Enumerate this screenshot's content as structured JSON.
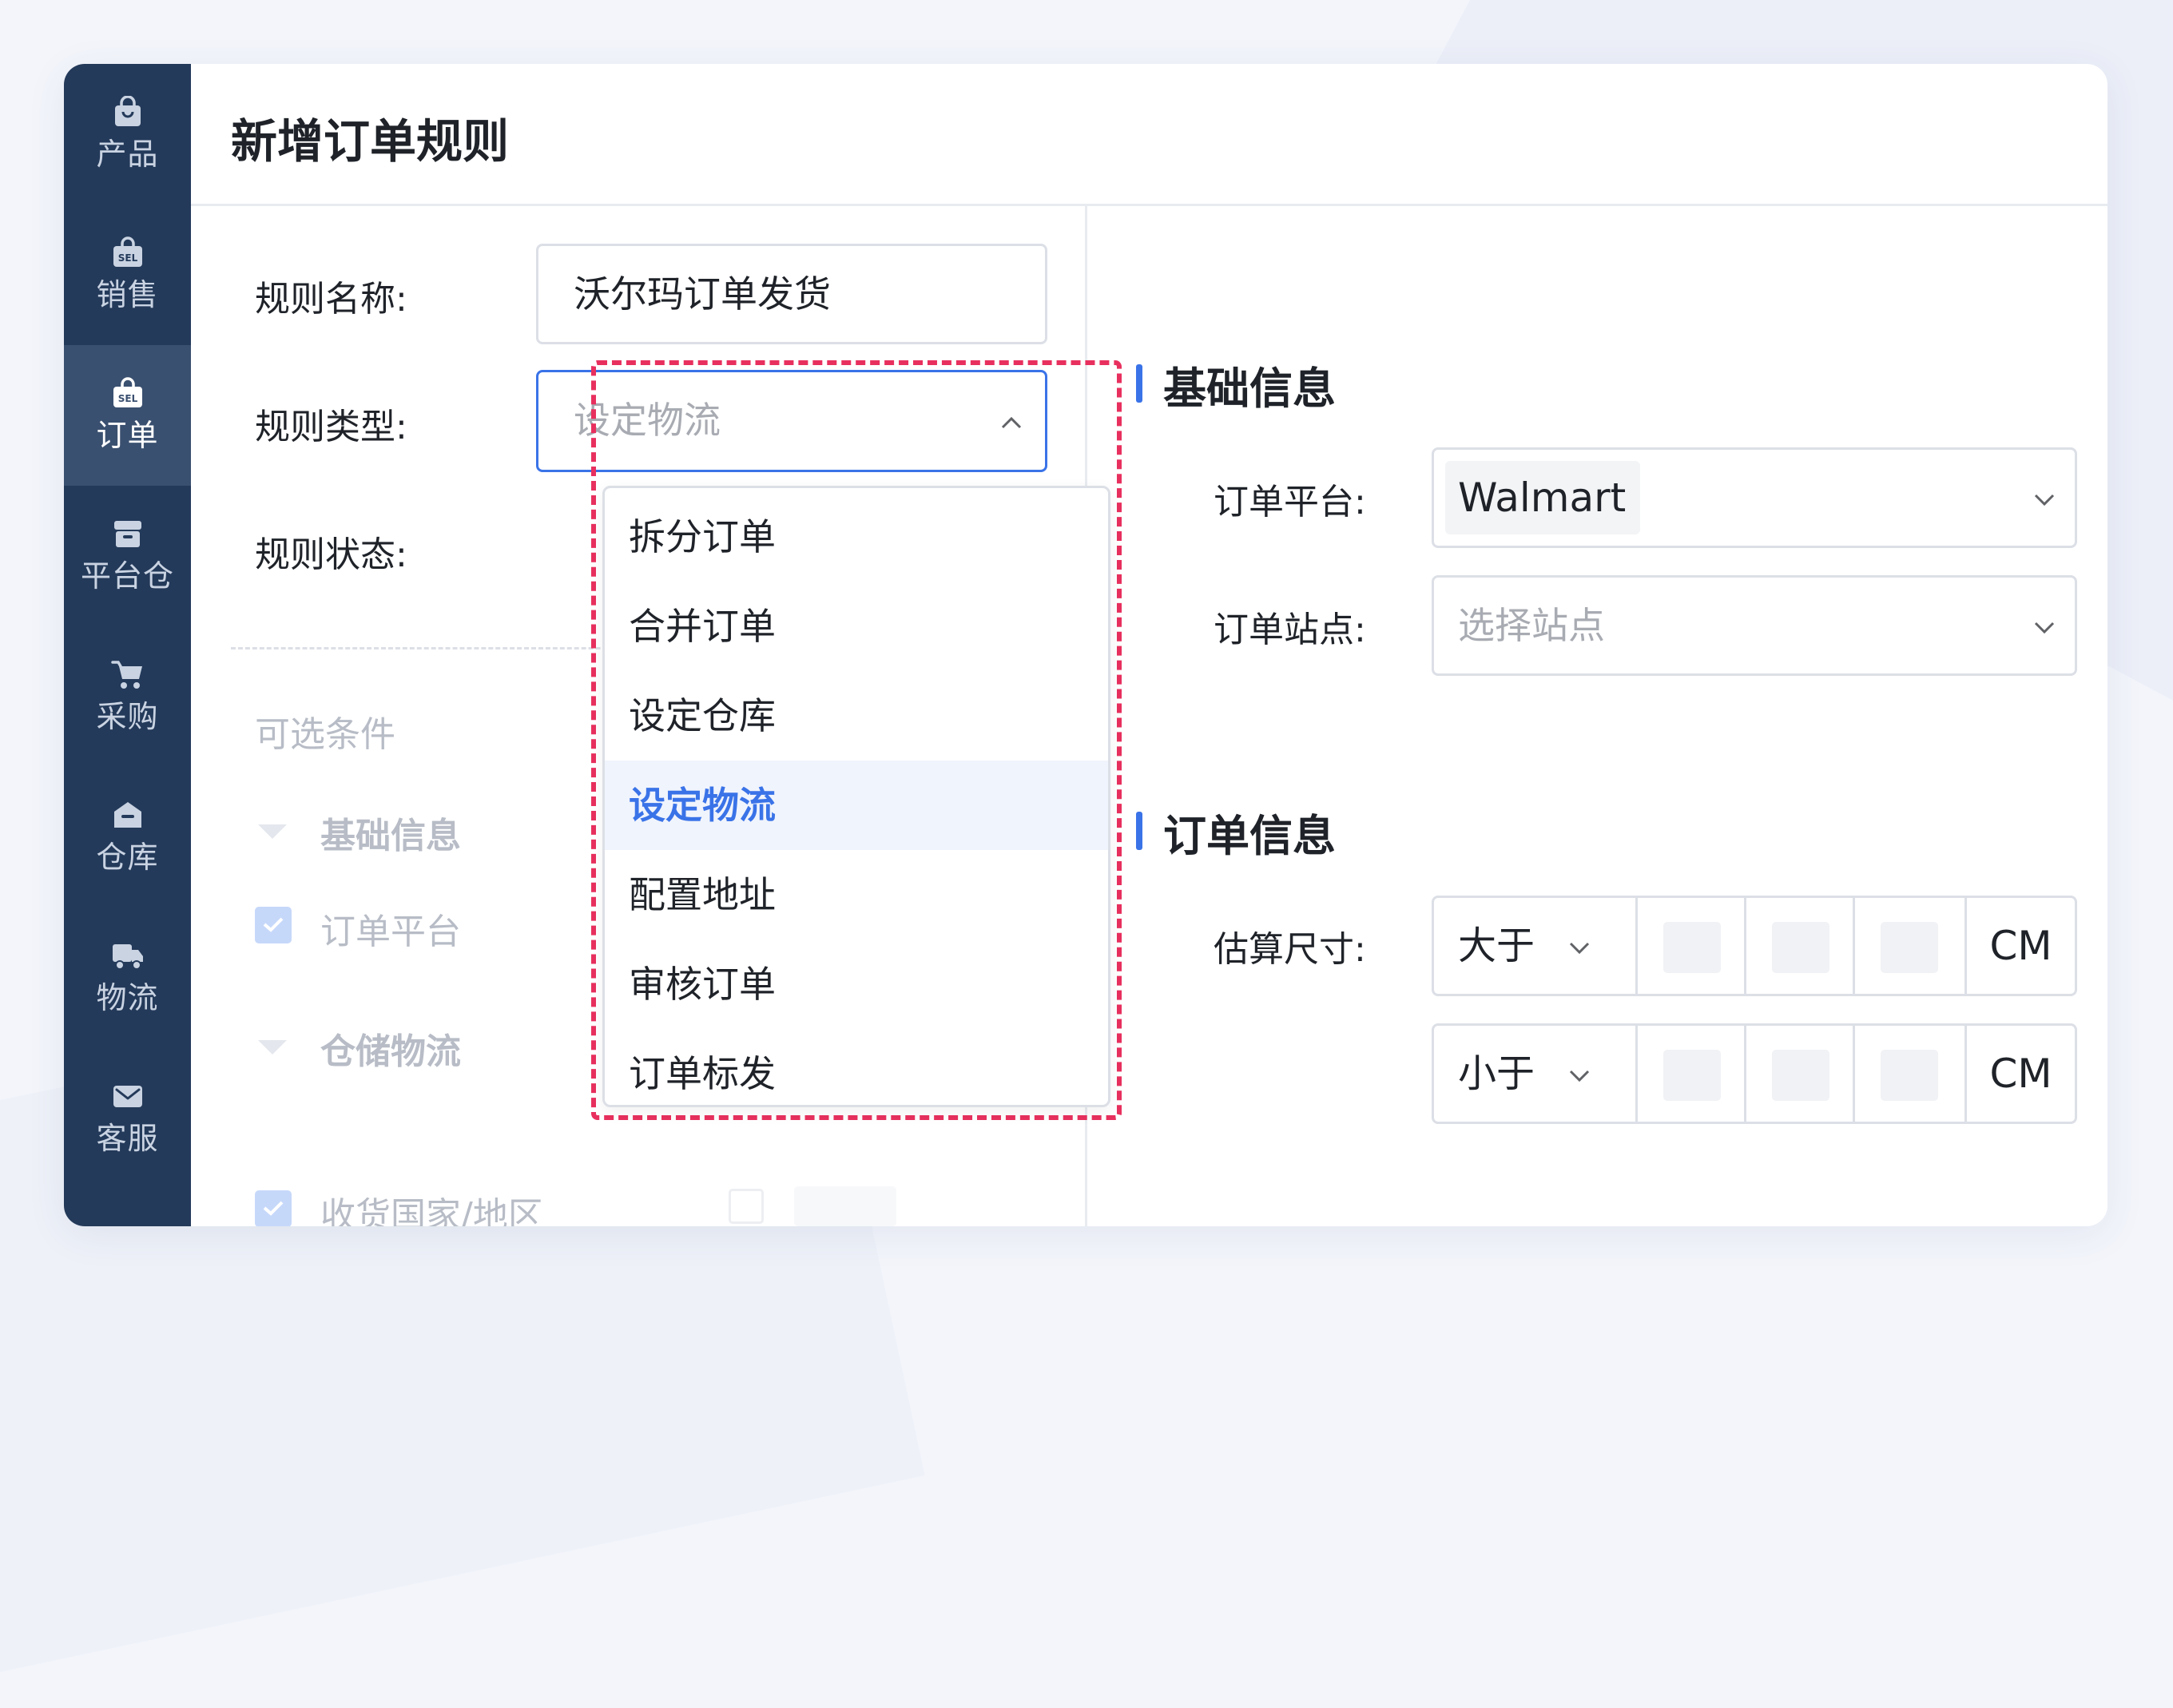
{
  "sidebar": {
    "items": [
      {
        "label": "产品",
        "icon": "bag-icon"
      },
      {
        "label": "销售",
        "icon": "sel-bag-icon"
      },
      {
        "label": "订单",
        "icon": "sel-bag-icon",
        "active": true
      },
      {
        "label": "平台仓",
        "icon": "box-icon"
      },
      {
        "label": "采购",
        "icon": "cart-icon"
      },
      {
        "label": "仓库",
        "icon": "warehouse-icon"
      },
      {
        "label": "物流",
        "icon": "truck-icon"
      },
      {
        "label": "客服",
        "icon": "mail-icon"
      }
    ],
    "badge_text": "SEL"
  },
  "header": {
    "title": "新增订单规则"
  },
  "left_form": {
    "rule_name_label": "规则名称:",
    "rule_name_value": "沃尔玛订单发货",
    "rule_type_label": "规则类型:",
    "rule_type_value": "设定物流",
    "rule_status_label": "规则状态:",
    "optional_conditions": "可选条件",
    "group_basic": "基础信息",
    "cond_order_platform": "订单平台",
    "group_storage": "仓储物流",
    "cond_ship_country": "收货国家/地区"
  },
  "dropdown": {
    "options": [
      "拆分订单",
      "合并订单",
      "设定仓库",
      "设定物流",
      "配置地址",
      "审核订单",
      "订单标发"
    ],
    "selected": "设定物流"
  },
  "right_panel": {
    "basic_section": "基础信息",
    "platform_label": "订单平台:",
    "platform_value": "Walmart",
    "site_label": "订单站点:",
    "site_placeholder": "选择站点",
    "order_section": "订单信息",
    "size_label": "估算尺寸:",
    "size_rows": [
      {
        "operator": "大于",
        "unit": "CM"
      },
      {
        "operator": "小于",
        "unit": "CM"
      }
    ]
  },
  "colors": {
    "accent": "#3a73e8",
    "sidebar": "#243a5a",
    "highlight_border": "#e8305e"
  }
}
